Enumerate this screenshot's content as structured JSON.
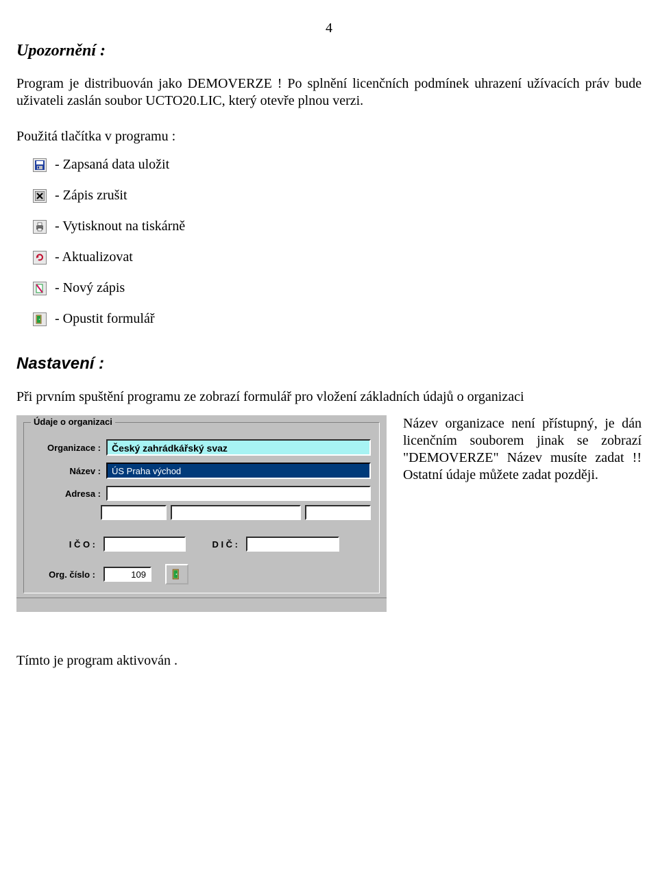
{
  "page_number": "4",
  "headings": {
    "warning": "Upozornění :",
    "settings": "Nastavení :"
  },
  "paragraphs": {
    "intro": "Program je distribuován jako DEMOVERZE ! Po splnění licenčních podmínek uhrazení užívacích práv bude uživateli zaslán soubor UCTO20.LIC, který otevře plnou verzi.",
    "buttons_used": "Použitá tlačítka v programu :",
    "settings_intro": "Při prvním spuštění programu ze zobrazí formulář pro vložení základních údajů o organizaci",
    "right_note": "Název organizace není přístupný, je dán licenčním souborem jinak se zobrazí \"DEMOVERZE\" Název musíte zadat !! Ostatní údaje můžete zadat později.",
    "footer": "Tímto je program aktivován ."
  },
  "buttons": {
    "save": "- Zapsaná data uložit",
    "cancel": "- Zápis zrušit",
    "print": "-  Vytisknout na tiskárně",
    "refresh": "-  Aktualizovat",
    "new": "-  Nový zápis",
    "exit": "- Opustit formulář"
  },
  "dialog": {
    "legend": "Údaje o organizaci",
    "labels": {
      "organizace": "Organizace :",
      "nazev": "Název :",
      "adresa": "Adresa :",
      "ico": "I Č O :",
      "dic": "D I Č :",
      "org_cislo": "Org. číslo :"
    },
    "values": {
      "organizace": "Český zahrádkářský svaz",
      "nazev": "ÚS Praha východ",
      "adresa1": "",
      "adresa_psc": "",
      "adresa_mesto": "",
      "adresa_zeme": "",
      "ico": "",
      "dic": "",
      "org_cislo": "109"
    }
  },
  "icons": {
    "save": "save-icon",
    "cancel": "cancel-icon",
    "print": "print-icon",
    "refresh": "refresh-icon",
    "new": "new-icon",
    "exit": "exit-icon"
  }
}
